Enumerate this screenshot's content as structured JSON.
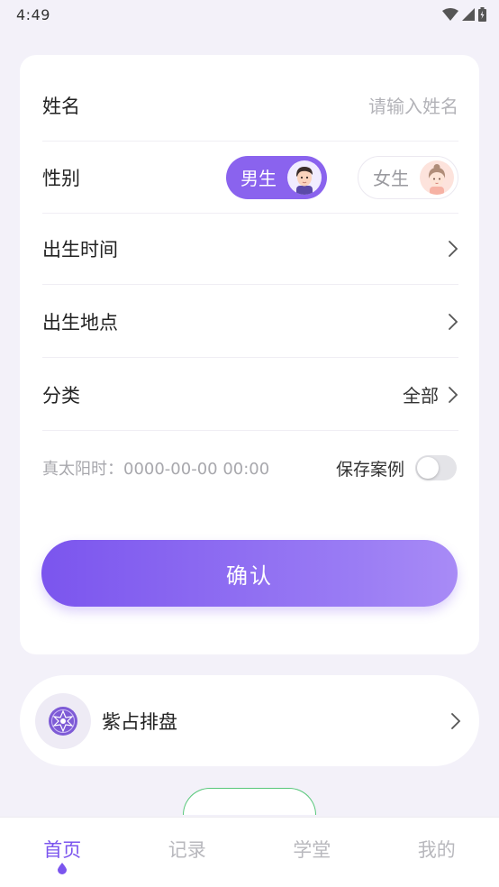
{
  "status_bar": {
    "time": "4:49"
  },
  "form": {
    "name": {
      "label": "姓名",
      "placeholder": "请输入姓名"
    },
    "gender": {
      "label": "性别",
      "male": "男生",
      "female": "女生",
      "selected": "男生"
    },
    "birth_time": {
      "label": "出生时间"
    },
    "birth_place": {
      "label": "出生地点"
    },
    "category": {
      "label": "分类",
      "value": "全部"
    },
    "solar_time": {
      "text": "真太阳时：0000-00-00 00:00"
    },
    "save_case": {
      "label": "保存案例",
      "enabled": false
    },
    "confirm": {
      "label": "确认"
    }
  },
  "feature": {
    "label": "紫占排盘",
    "icon": "star-emblem-icon"
  },
  "tabs": [
    {
      "label": "首页",
      "active": true
    },
    {
      "label": "记录",
      "active": false
    },
    {
      "label": "学堂",
      "active": false
    },
    {
      "label": "我的",
      "active": false
    }
  ],
  "colors": {
    "accent": "#7b55ee",
    "background": "#f3f1f9"
  }
}
